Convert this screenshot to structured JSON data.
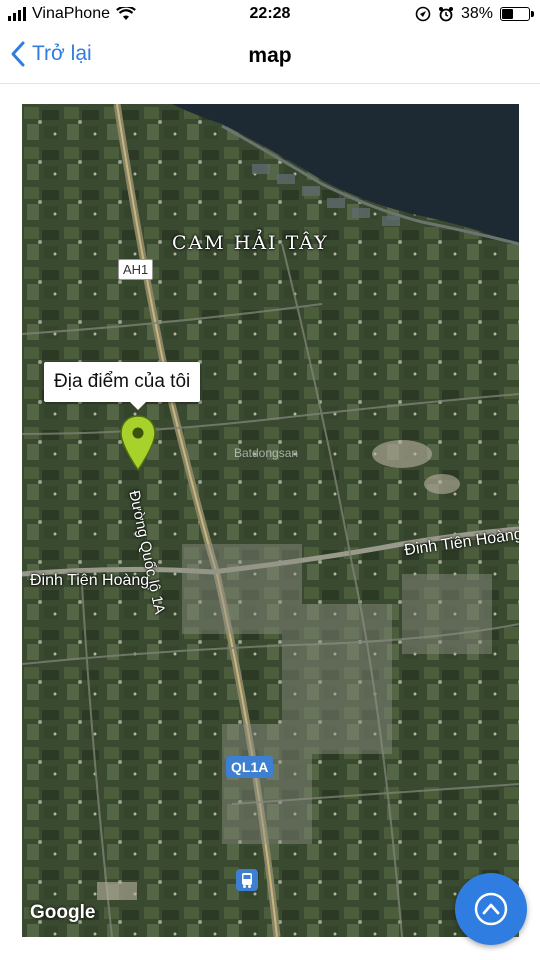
{
  "status_bar": {
    "carrier": "VinaPhone",
    "time": "22:28",
    "battery": "38%",
    "icons": [
      "signal-icon",
      "wifi-icon",
      "location-lock-icon",
      "alarm-icon",
      "battery-icon"
    ]
  },
  "nav": {
    "back_label": "Trở lại",
    "title": "map",
    "accent": "#2f7de1"
  },
  "map": {
    "area_label": "CAM HẢI TÂY",
    "highway_badge": "AH1",
    "road_badge": "QL1A",
    "road_name": "Đường Quốc lộ 1A",
    "street_left": "Đinh Tiên Hoàng",
    "street_right": "Đinh Tiên Hoàng",
    "callout": "Địa điểm của tôi",
    "watermark": "Batdongsan",
    "provider": "Google",
    "pin_color": "#a7d12b",
    "badge_color": "#3d7fd1"
  },
  "fab": {
    "icon": "chevron-up-icon",
    "color": "#2f7de1"
  }
}
